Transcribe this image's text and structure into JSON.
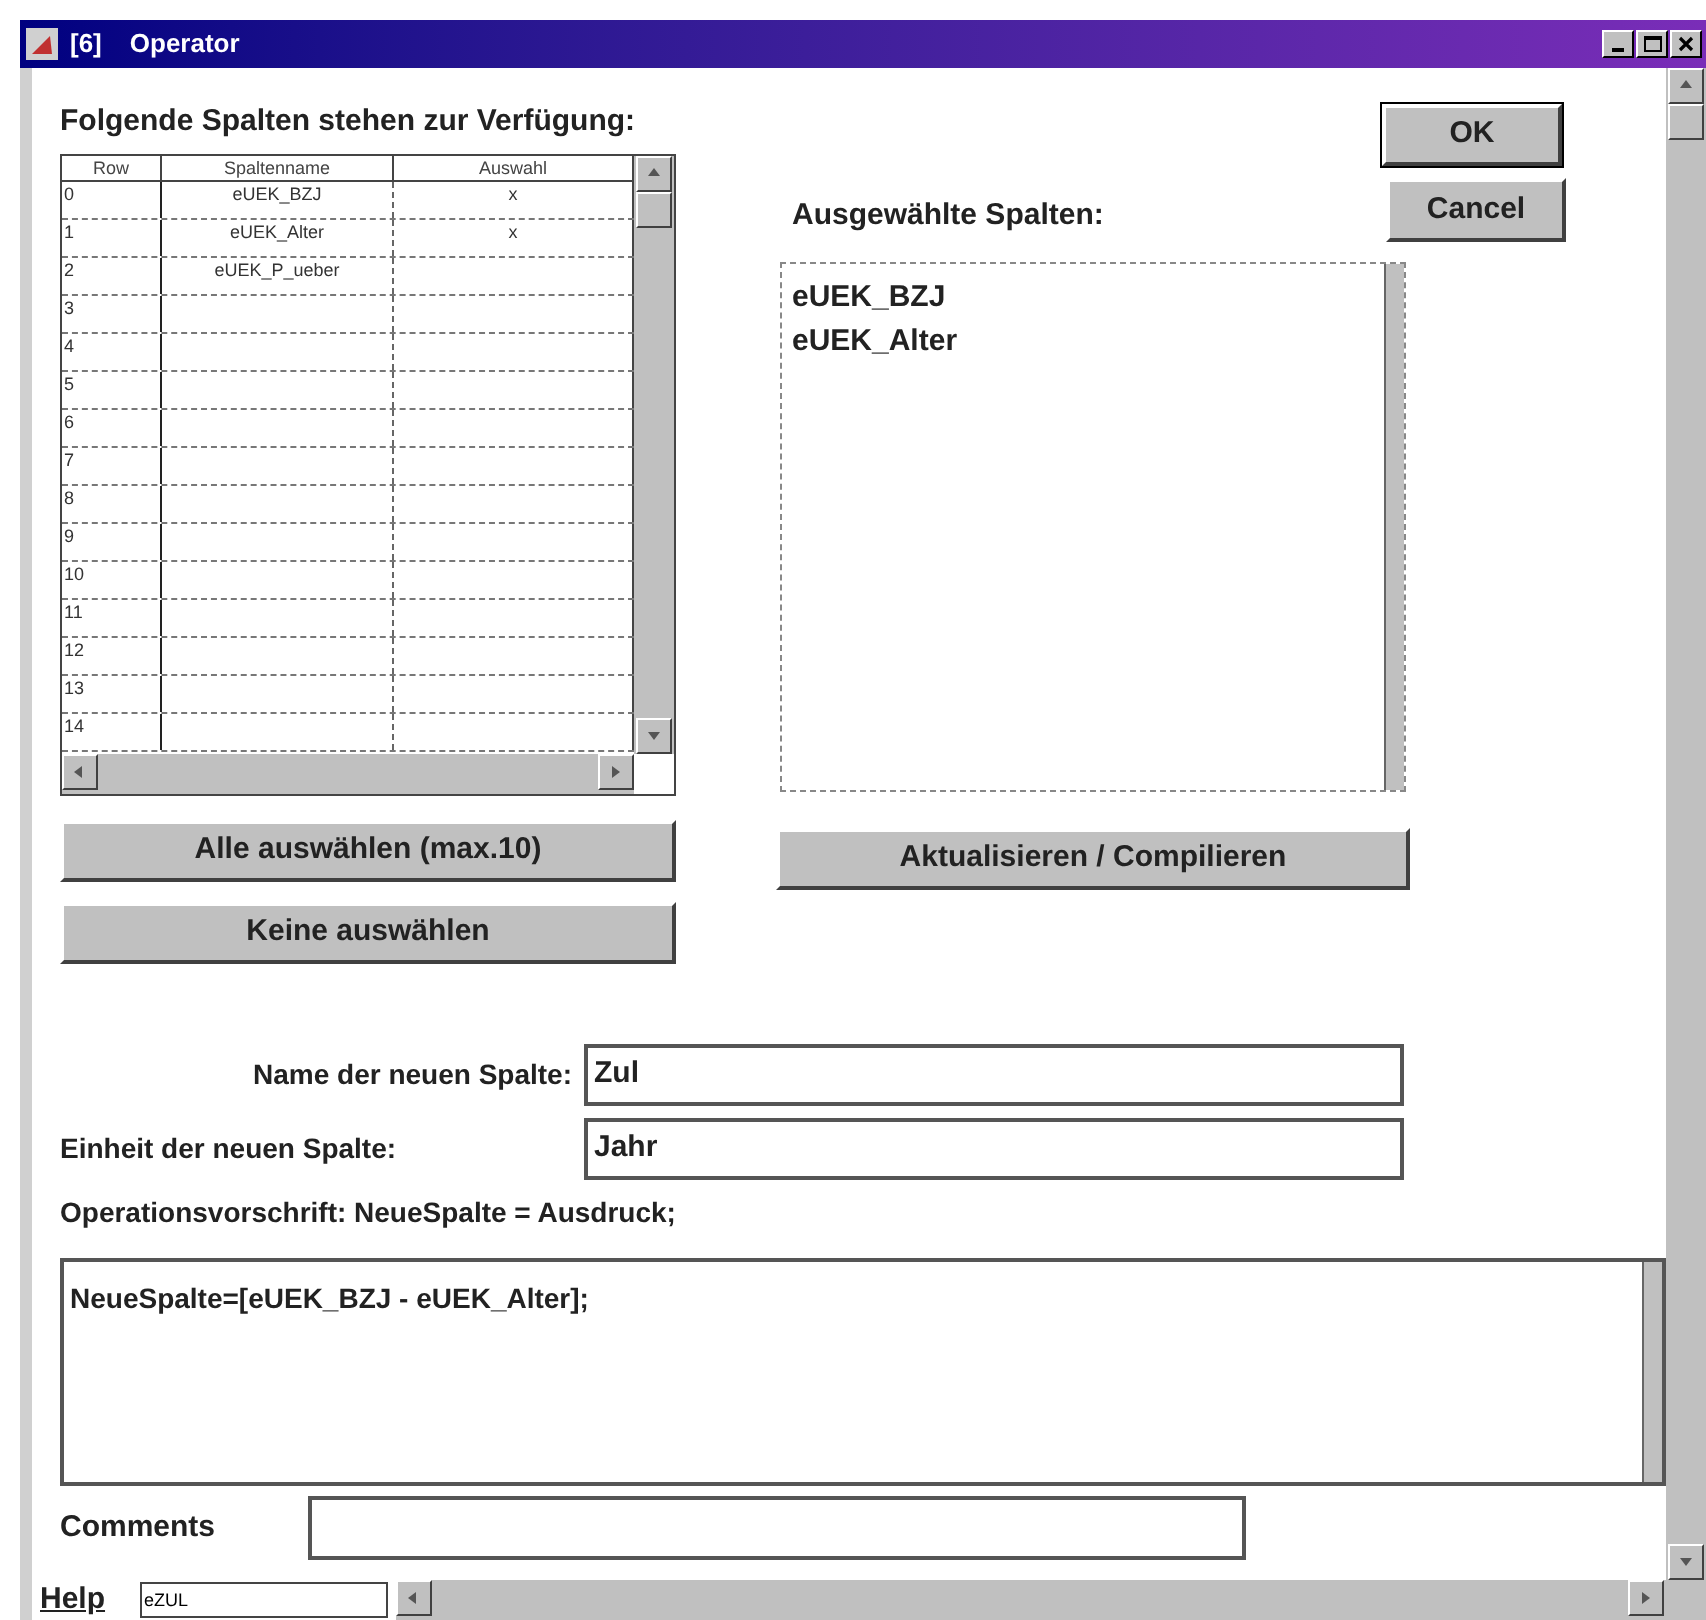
{
  "window": {
    "prefix": "[6]",
    "title": "Operator"
  },
  "available": {
    "heading": "Folgende Spalten stehen zur Verfügung:",
    "columns": [
      "Row",
      "Spaltenname",
      "Auswahl"
    ],
    "rows": [
      {
        "cells": [
          "0",
          "eUEK_BZJ",
          "x"
        ]
      },
      {
        "cells": [
          "1",
          "eUEK_Alter",
          "x"
        ]
      },
      {
        "cells": [
          "2",
          "eUEK_P_ueber",
          ""
        ]
      },
      {
        "cells": [
          "3",
          "",
          ""
        ]
      },
      {
        "cells": [
          "4",
          "",
          ""
        ]
      },
      {
        "cells": [
          "5",
          "",
          ""
        ]
      },
      {
        "cells": [
          "6",
          "",
          ""
        ]
      },
      {
        "cells": [
          "7",
          "",
          ""
        ]
      },
      {
        "cells": [
          "8",
          "",
          ""
        ]
      },
      {
        "cells": [
          "9",
          "",
          ""
        ]
      },
      {
        "cells": [
          "10",
          "",
          ""
        ]
      },
      {
        "cells": [
          "11",
          "",
          ""
        ]
      },
      {
        "cells": [
          "12",
          "",
          ""
        ]
      },
      {
        "cells": [
          "13",
          "",
          ""
        ]
      },
      {
        "cells": [
          "14",
          "",
          ""
        ]
      }
    ]
  },
  "selected": {
    "heading": "Ausgewählte Spalten:",
    "items": [
      "eUEK_BZJ",
      "eUEK_Alter"
    ]
  },
  "ok_button": "OK",
  "cancel_button": "Cancel",
  "select_all_button": "Alle auswählen (max.10)",
  "select_none_button": "Keine auswählen",
  "update_button": "Aktualisieren / Compilieren",
  "name_field": {
    "label": "Name der neuen Spalte:",
    "value": "Zul"
  },
  "unit_field": {
    "label": "Einheit der neuen Spalte:",
    "value": "Jahr"
  },
  "rule_label": "Operationsvorschrift: NeueSpalte = Ausdruck;",
  "expression": "NeueSpalte=[eUEK_BZJ - eUEK_Alter];",
  "comments": {
    "label": "Comments"
  },
  "status": {
    "help": "Help",
    "field": "eZUL"
  }
}
